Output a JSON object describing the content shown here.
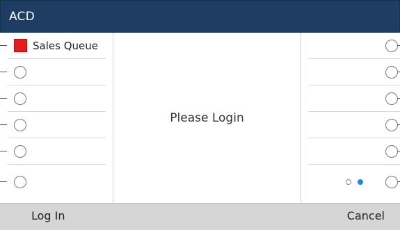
{
  "window": {
    "title": "ACD"
  },
  "left_keys": [
    {
      "label": "Sales Queue",
      "icon": "queue-status-square-icon",
      "color": "#e02020"
    },
    {
      "label": "",
      "icon": "line-key-circle-icon"
    },
    {
      "label": "",
      "icon": "line-key-circle-icon"
    },
    {
      "label": "",
      "icon": "line-key-circle-icon"
    },
    {
      "label": "",
      "icon": "line-key-circle-icon"
    },
    {
      "label": "",
      "icon": "line-key-circle-icon"
    }
  ],
  "right_keys": [
    {
      "label": "",
      "icon": "line-key-circle-icon"
    },
    {
      "label": "",
      "icon": "line-key-circle-icon"
    },
    {
      "label": "",
      "icon": "line-key-circle-icon"
    },
    {
      "label": "",
      "icon": "line-key-circle-icon"
    },
    {
      "label": "",
      "icon": "line-key-circle-icon"
    },
    {
      "label": "",
      "icon": "line-key-circle-icon"
    }
  ],
  "main": {
    "message": "Please Login"
  },
  "pagination": {
    "pages": 2,
    "current": 2,
    "active_color": "#1a8ad4"
  },
  "softkeys": {
    "left": "Log In",
    "right": "Cancel"
  },
  "colors": {
    "titlebar": "#1f3d63",
    "softkey_bar": "#d6d6d6",
    "queue_alert": "#e02020"
  }
}
